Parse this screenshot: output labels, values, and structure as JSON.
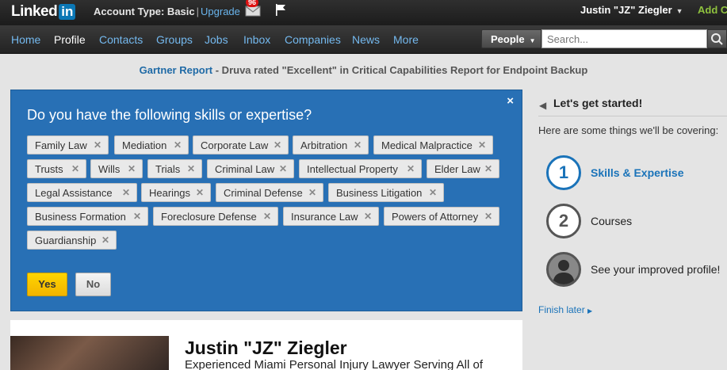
{
  "colors": {
    "accent_blue": "#2870b5",
    "yes_yellow": "#f2b400",
    "link_blue": "#1a73b9"
  },
  "topbar": {
    "logo_text": "Linked",
    "logo_in": "in",
    "account_label": "Account Type: Basic",
    "separator": "|",
    "upgrade": "Upgrade",
    "message_count": "96",
    "user_name": "Justin \"JZ\" Ziegler",
    "add_connections": "Add C"
  },
  "nav": {
    "items": [
      {
        "label": "Home"
      },
      {
        "label": "Profile"
      },
      {
        "label": "Contacts"
      },
      {
        "label": "Groups"
      },
      {
        "label": "Jobs"
      },
      {
        "label": "Inbox"
      },
      {
        "label": "Companies"
      },
      {
        "label": "News"
      },
      {
        "label": "More"
      }
    ],
    "active": "Profile",
    "search_scope": "People",
    "search_placeholder": "Search..."
  },
  "ad": {
    "link": "Gartner Report",
    "text": " - Druva rated \"Excellent\" in Critical Capabilities Report for Endpoint Backup"
  },
  "skills_panel": {
    "title": "Do you have the following skills or expertise?",
    "close": "×",
    "skills": [
      "Family Law",
      "Mediation",
      "Corporate Law",
      "Arbitration",
      "Medical Malpractice",
      "Trusts",
      "Wills",
      "Trials",
      "Criminal Law",
      "Intellectual Property",
      "Elder Law",
      "Legal Assistance",
      "Hearings",
      "Criminal Defense",
      "Business Litigation",
      "Business Formation",
      "Foreclosure Defense",
      "Insurance Law",
      "Powers of Attorney",
      "Guardianship"
    ],
    "yes": "Yes",
    "no": "No"
  },
  "sidebar": {
    "heading": "Let's get started!",
    "intro": "Here are some things we'll be covering:",
    "steps": [
      {
        "number": "1",
        "label": "Skills & Expertise",
        "active": true
      },
      {
        "number": "2",
        "label": "Courses",
        "active": false
      },
      {
        "number": "",
        "label": "See your improved profile!",
        "active": false
      }
    ],
    "finish_later": "Finish later"
  },
  "profile": {
    "name": "Justin \"JZ\" Ziegler",
    "headline": "Experienced Miami Personal Injury Lawyer Serving All of"
  }
}
